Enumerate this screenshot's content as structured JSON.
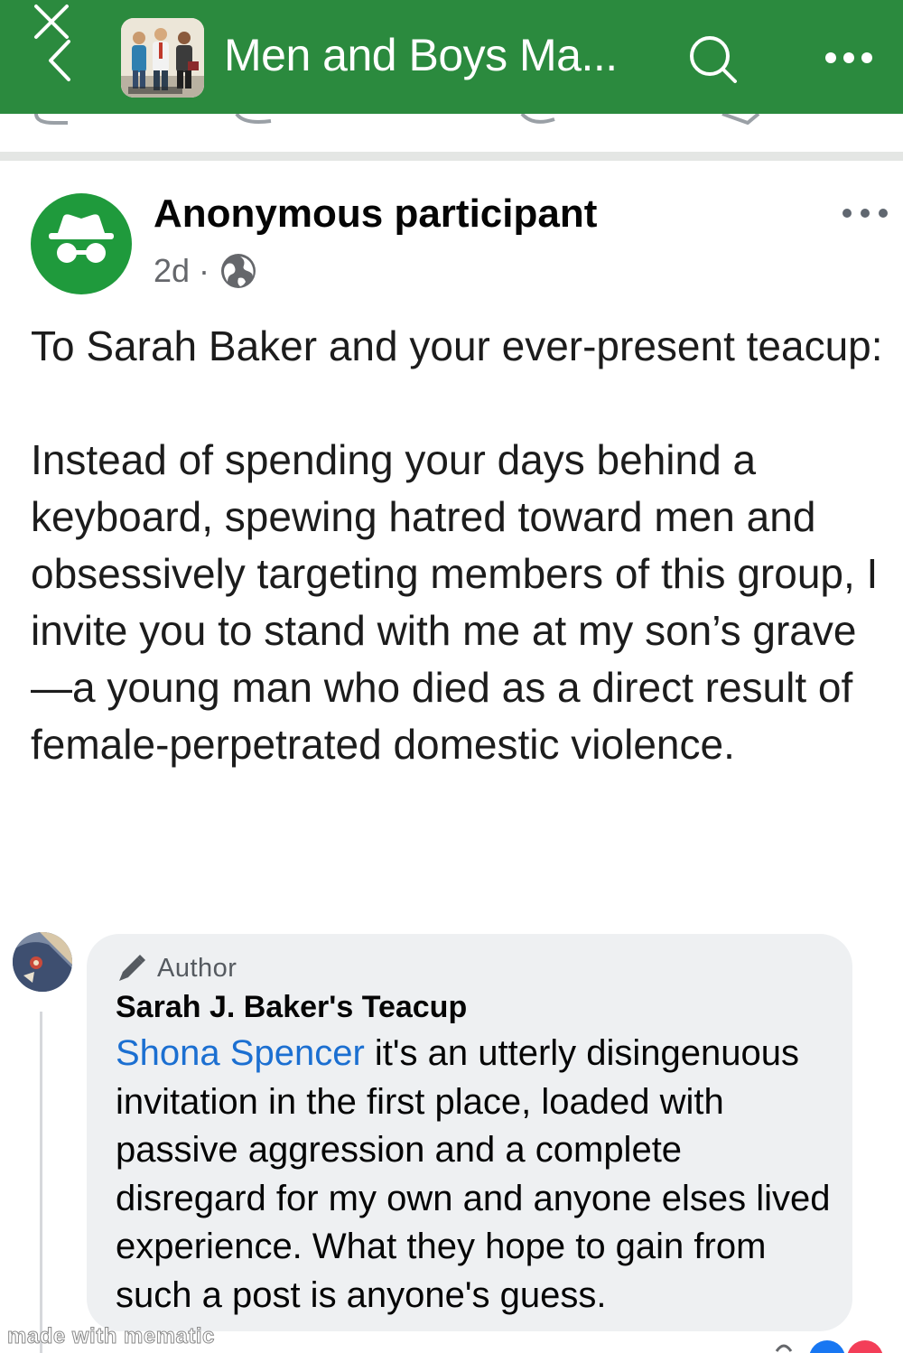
{
  "header": {
    "group_name": "Men and Boys Ma...",
    "accent_color": "#2b8a3e",
    "icons": [
      "close-icon",
      "back-chevron-icon",
      "group-avatar",
      "search-icon",
      "more-options-icon"
    ]
  },
  "post": {
    "author": "Anonymous participant",
    "time": "2d",
    "separator": "·",
    "privacy_icon": "globe-icon",
    "avatar_icon": "incognito-icon",
    "avatar_color": "#1f9a3c",
    "body": [
      "To Sarah Baker and your ever-present teacup:",
      "Instead of spending your days behind a keyboard, spewing hatred toward men and obsessively targeting members of this group, I invite you to stand with me at my son’s grave—a young man who died as a direct result of female-perpetrated domestic violence."
    ]
  },
  "comment": {
    "badge_label": "Author",
    "badge_icon": "pen-icon",
    "name": "Sarah J. Baker's Teacup",
    "mention": "Shona Spencer",
    "mention_color": "#1b6fd1",
    "text": " it's an utterly disingenuous invitation in the first place, loaded with passive aggression and a complete disregard for my own and anyone elses lived experience. What they hope to gain from such a post is anyone's guess."
  },
  "watermark": "made with mematic"
}
